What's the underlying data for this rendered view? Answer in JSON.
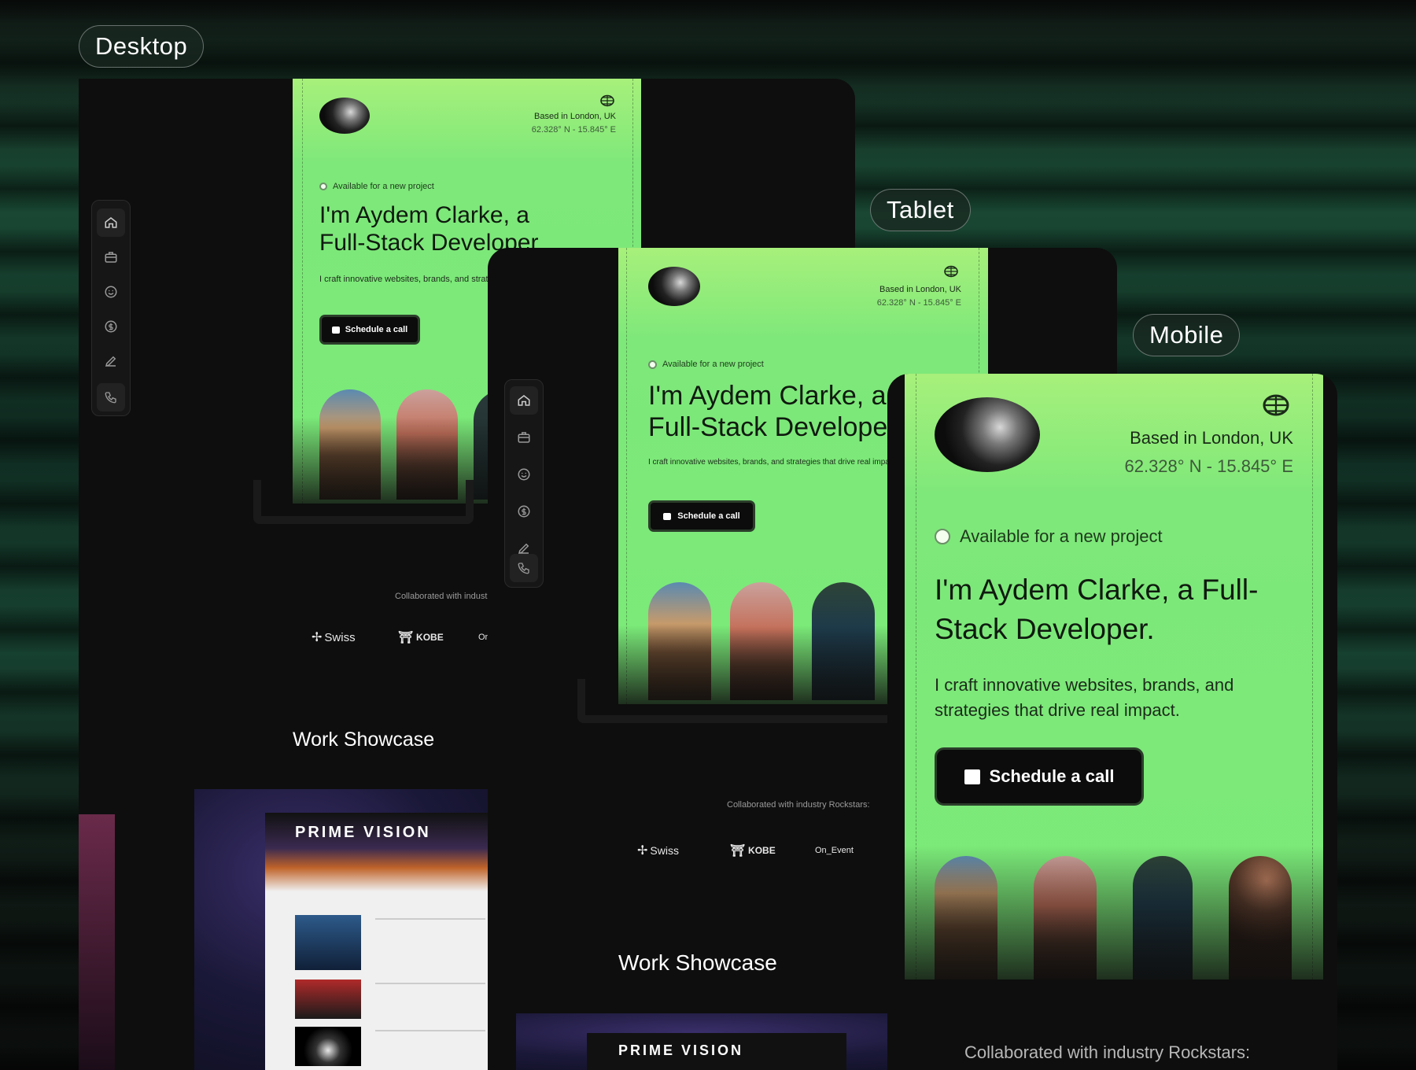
{
  "labels": {
    "desktop": "Desktop",
    "tablet": "Tablet",
    "mobile": "Mobile"
  },
  "hero": {
    "location": "Based in London, UK",
    "coordinates": "62.328° N - 15.845° E",
    "availability": "Available for a new project",
    "headline_line1": "I'm Aydem Clarke, a",
    "headline_line2": "Full-Stack Developer",
    "headline_mobile": "I'm Aydem Clarke, a Full-Stack Developer.",
    "subtitle": "I craft innovative websites, brands, and strategies that drive real impact.",
    "cta": "Schedule a call"
  },
  "collab": {
    "desktop_heading": "Collaborated with indust",
    "tablet_heading": "Collaborated with industry Rockstars:",
    "mobile_heading": "Collaborated with industry Rockstars:",
    "brands": [
      "Swiss",
      "KOBE",
      "On",
      "On_Event"
    ]
  },
  "showcase": {
    "title": "Work Showcase",
    "project_title": "PRIME VISION"
  },
  "sidebar": {
    "items": [
      "home-icon",
      "briefcase-icon",
      "smiley-icon",
      "dollar-icon",
      "pen-icon",
      "phone-icon"
    ]
  },
  "colors": {
    "accent_green": "#7ee87a",
    "dark_panel": "#0e0e0e"
  }
}
